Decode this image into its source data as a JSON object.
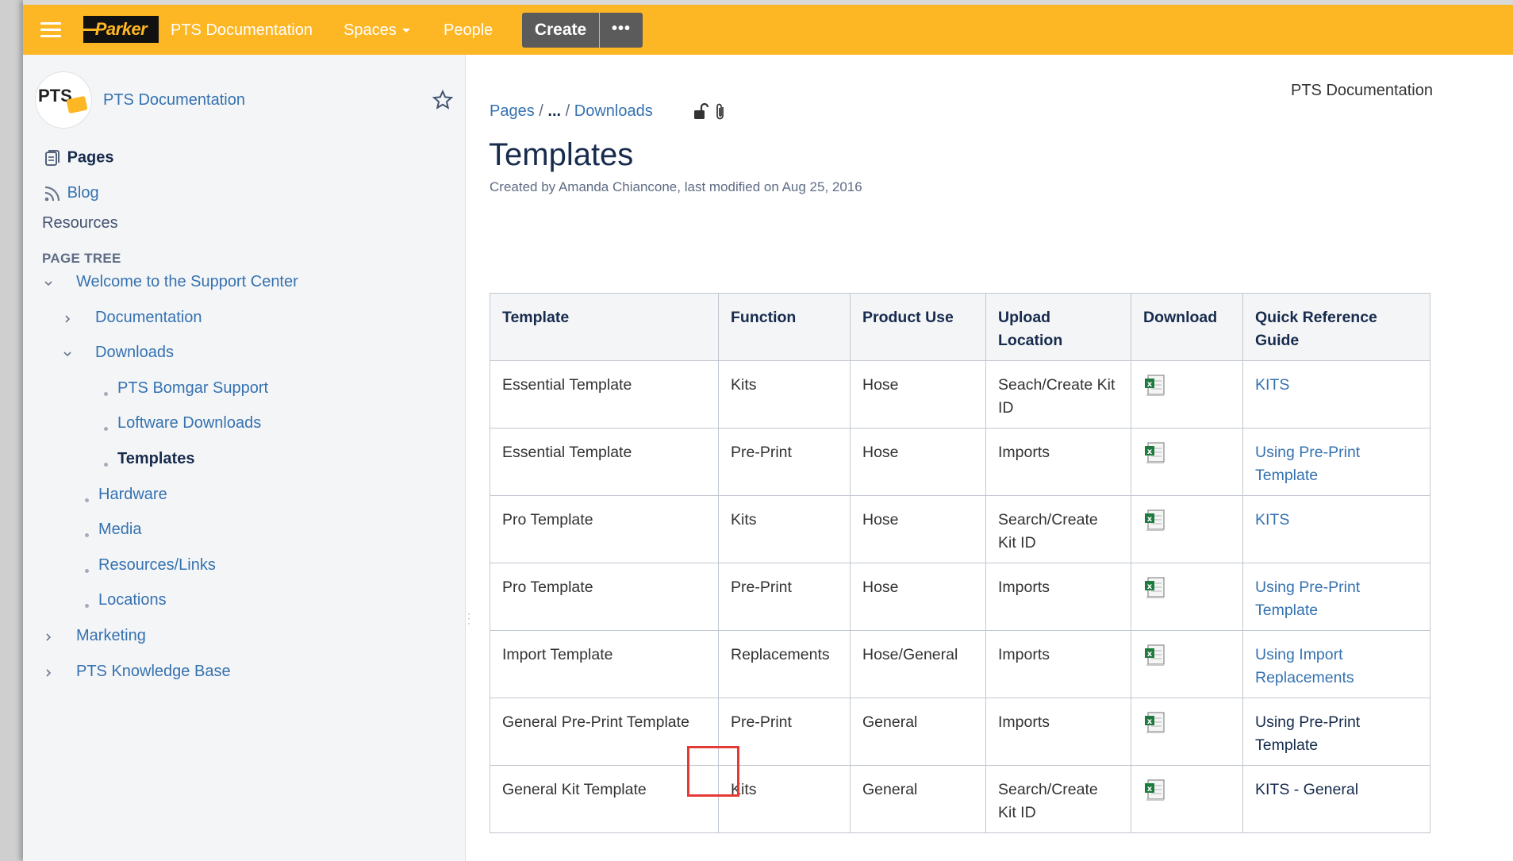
{
  "header": {
    "app_name": "PTS Documentation",
    "logo_text": "Parker",
    "spaces_label": "Spaces",
    "people_label": "People",
    "create_label": "Create",
    "more_label": "•••",
    "colors": {
      "bar": "#fdb624",
      "button": "#5b5b5b"
    }
  },
  "sidebar": {
    "space_name": "PTS Documentation",
    "avatar_text": "PTS",
    "pages_label": "Pages",
    "blog_label": "Blog",
    "resources_label": "Resources",
    "page_tree_label": "PAGE TREE",
    "tree": [
      {
        "label": "Welcome to the Support Center",
        "level": 0,
        "icon": "chevron-down-icon"
      },
      {
        "label": "Documentation",
        "level": 1,
        "icon": "chevron-right-icon"
      },
      {
        "label": "Downloads",
        "level": 1,
        "icon": "chevron-down-icon"
      },
      {
        "label": "PTS Bomgar Support",
        "level": 2,
        "icon": "bullet"
      },
      {
        "label": "Loftware Downloads",
        "level": 2,
        "icon": "bullet"
      },
      {
        "label": "Templates",
        "level": 2,
        "icon": "bullet",
        "current": true
      },
      {
        "label": "Hardware",
        "level": 1,
        "icon": "bullet"
      },
      {
        "label": "Media",
        "level": 1,
        "icon": "bullet"
      },
      {
        "label": "Resources/Links",
        "level": 1,
        "icon": "bullet"
      },
      {
        "label": "Locations",
        "level": 1,
        "icon": "bullet"
      },
      {
        "label": "Marketing",
        "level": 0,
        "icon": "chevron-right-icon"
      },
      {
        "label": "PTS Knowledge Base",
        "level": 0,
        "icon": "chevron-right-icon"
      }
    ]
  },
  "main": {
    "space_title": "PTS Documentation",
    "breadcrumb": {
      "pages": "Pages",
      "sep1": "/",
      "ellipsis": "...",
      "sep2": "/",
      "downloads": "Downloads"
    },
    "title": "Templates",
    "byline": "Created by Amanda Chiancone, last modified on Aug 25, 2016",
    "table": {
      "headers": [
        "Template",
        "Function",
        "Product Use",
        "Upload Location",
        "Download",
        "Quick Reference Guide"
      ],
      "rows": [
        {
          "template": "Essential Template",
          "function": "Kits",
          "product_use": "Hose",
          "upload": "Seach/Create Kit ID",
          "guide": "KITS",
          "guide_link": true
        },
        {
          "template": "Essential Template",
          "function": "Pre-Print",
          "product_use": "Hose",
          "upload": "Imports",
          "guide": "Using Pre-Print Template",
          "guide_link": true
        },
        {
          "template": "Pro Template",
          "function": "Kits",
          "product_use": "Hose",
          "upload": "Search/Create Kit ID",
          "guide": "KITS",
          "guide_link": true
        },
        {
          "template": "Pro Template",
          "function": "Pre-Print",
          "product_use": "Hose",
          "upload": "Imports",
          "guide": "Using Pre-Print Template",
          "guide_link": true
        },
        {
          "template": "Import Template",
          "function": "Replacements",
          "product_use": "Hose/General",
          "upload": "Imports",
          "guide": "Using Import Replacements",
          "guide_link": true
        },
        {
          "template": "General Pre-Print Template",
          "function": "Pre-Print",
          "product_use": "General",
          "upload": "Imports",
          "guide": "Using Pre-Print Template",
          "guide_link": false
        },
        {
          "template": "General Kit Template",
          "function": "Kits",
          "product_use": "General",
          "upload": "Search/Create Kit ID",
          "guide": "KITS - General",
          "guide_link": false
        }
      ]
    }
  }
}
